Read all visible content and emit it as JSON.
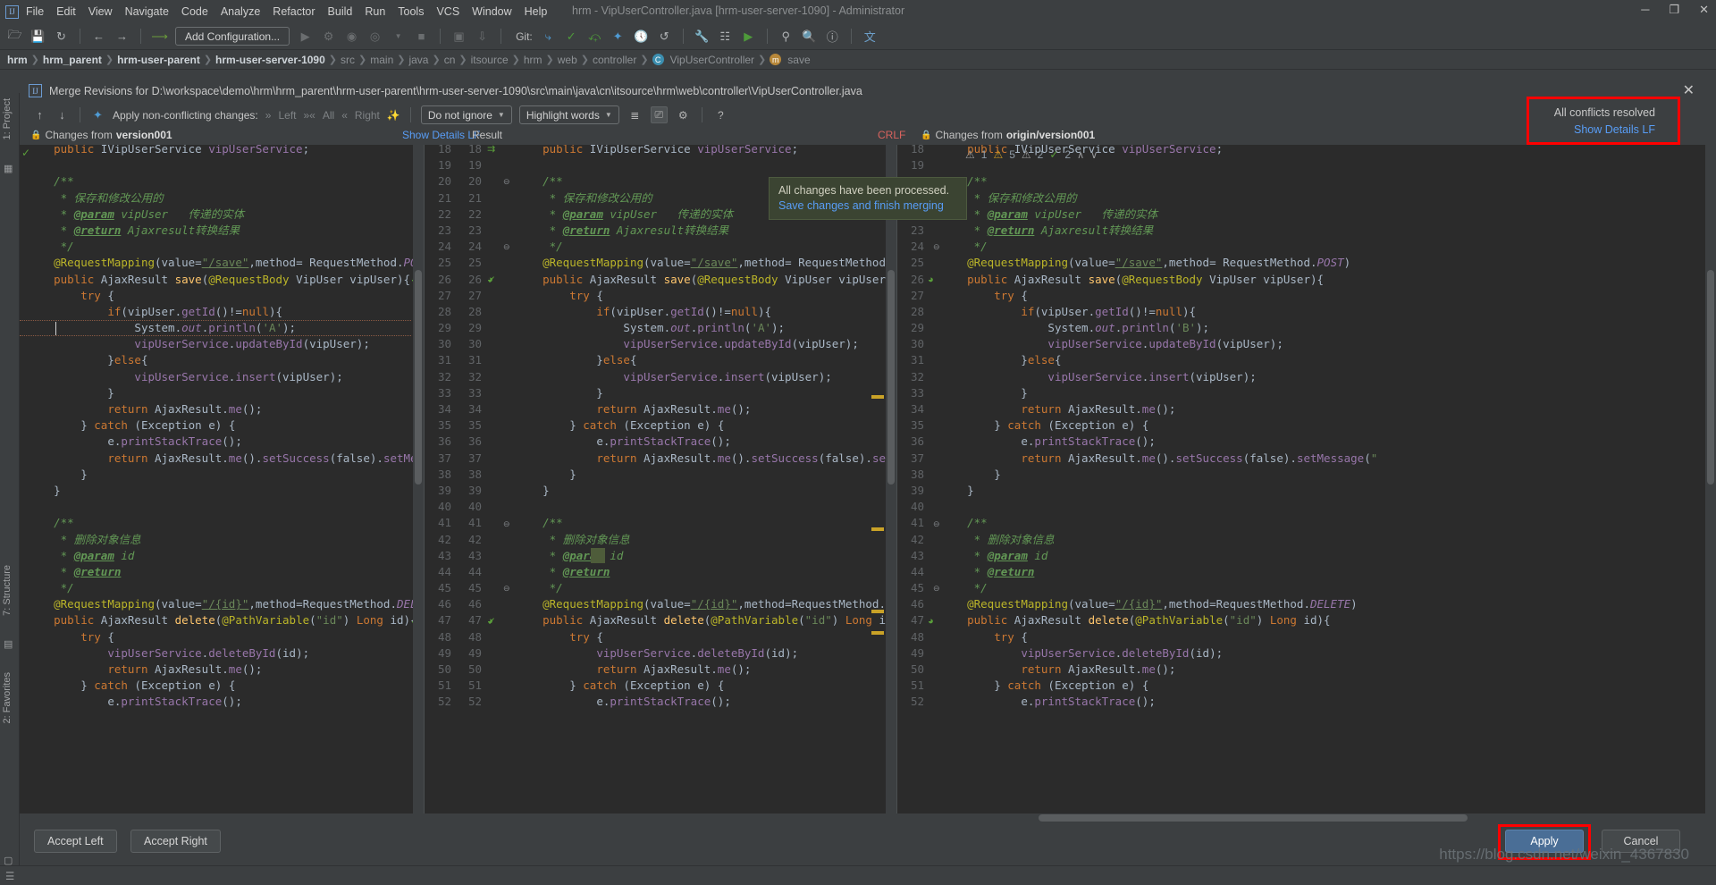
{
  "window": {
    "title": "hrm - VipUserController.java [hrm-user-server-1090] - Administrator",
    "minimize": "─",
    "maximize": "❐",
    "close": "✕",
    "logo": "IJ"
  },
  "menu": [
    "File",
    "Edit",
    "View",
    "Navigate",
    "Code",
    "Analyze",
    "Refactor",
    "Build",
    "Run",
    "Tools",
    "VCS",
    "Window",
    "Help"
  ],
  "toolbar": {
    "add_configuration": "Add Configuration...",
    "git_label": "Git:",
    "icons": [
      "folder-open-icon",
      "save-icon",
      "sync-icon",
      "back-arrow-icon",
      "forward-arrow-icon",
      "undo-arrow-icon",
      "run-icon",
      "debug-icon",
      "run-coverage-icon",
      "profile-icon",
      "stop-icon",
      "build-icon",
      "build-module-icon",
      "update-project-icon",
      "commit-icon",
      "push-icon",
      "revert-icon",
      "history-icon",
      "undo-icon",
      "settings-wrench-icon",
      "project-structure-icon",
      "run-anything-icon",
      "search-everywhere-icon",
      "search-icon",
      "help-icon",
      "translate-icon"
    ]
  },
  "breadcrumbs": [
    {
      "label": "hrm",
      "style": "bold"
    },
    {
      "label": "hrm_parent",
      "style": "bold"
    },
    {
      "label": "hrm-user-parent",
      "style": "bold"
    },
    {
      "label": "hrm-user-server-1090",
      "style": "bold"
    },
    {
      "label": "src",
      "style": "dim"
    },
    {
      "label": "main",
      "style": "dim"
    },
    {
      "label": "java",
      "style": "dim"
    },
    {
      "label": "cn",
      "style": "dim"
    },
    {
      "label": "itsource",
      "style": "dim"
    },
    {
      "label": "hrm",
      "style": "dim"
    },
    {
      "label": "web",
      "style": "dim"
    },
    {
      "label": "controller",
      "style": "dim"
    },
    {
      "label": "VipUserController",
      "style": "class",
      "badge": "C"
    },
    {
      "label": "save",
      "style": "method",
      "badge": "m"
    }
  ],
  "left_strip": {
    "project_tab": "1: Project",
    "structure_tab": "7: Structure",
    "favorites_tab": "2: Favorites"
  },
  "editor_tab": "VipUserController.java",
  "merge_dialog": {
    "title": "Merge Revisions for D:\\workspace\\demo\\hrm\\hrm_parent\\hrm-user-parent\\hrm-user-server-1090\\src\\main\\java\\cn\\itsource\\hrm\\web\\controller\\VipUserController.java",
    "close_label": "✕",
    "apply_nonconflicting_label": "Apply non-conflicting changes:",
    "apply_left": "Left",
    "apply_all": "All",
    "apply_right": "Right",
    "ignore_select": "Do not ignore",
    "highlight_select": "Highlight words",
    "help_label": "?",
    "panes": {
      "left_title_prefix": "Changes from ",
      "left_title_rev": "version001",
      "show_details_left": "Show Details LF",
      "result_title": "Result",
      "crlf": "CRLF",
      "right_title_prefix": "Changes from ",
      "right_title_rev": "origin/version001",
      "show_details_right": "Show Details LF"
    },
    "inspection_widget": {
      "errors": "1",
      "warnings": "5",
      "weak_warnings": "2",
      "ok": "2",
      "up": "∧",
      "down": "∨"
    },
    "tooltip": {
      "line1": "All changes have been processed.",
      "line2": "Save changes and finish merging"
    },
    "resolved_badge": {
      "line1": "All conflicts resolved",
      "line2": "Show Details LF"
    },
    "buttons": {
      "accept_left": "Accept Left",
      "accept_right": "Accept Right",
      "apply": "Apply",
      "cancel": "Cancel"
    }
  },
  "code": {
    "left_start_line": 18,
    "lines_left": [
      {
        "n": 18,
        "t": "    public IVipUserService vipUserService;",
        "mark": "ok"
      },
      {
        "n": 19,
        "t": ""
      },
      {
        "n": 20,
        "t": "    /**",
        "fold": true
      },
      {
        "n": 21,
        "t": "     * 保存和修改公用的"
      },
      {
        "n": 22,
        "t": "     * @param vipUser   传递的实体"
      },
      {
        "n": 23,
        "t": "     * @return Ajaxresult转换结果"
      },
      {
        "n": 24,
        "t": "     */",
        "fold": true
      },
      {
        "n": 25,
        "t": "    @RequestMapping(value=\"/save\",method= RequestMethod.POST)"
      },
      {
        "n": 26,
        "t": "    public AjaxResult save(@RequestBody VipUser vipUser){",
        "bean": true
      },
      {
        "n": 27,
        "t": "        try {"
      },
      {
        "n": 28,
        "t": "            if(vipUser.getId()!=null){"
      },
      {
        "n": 29,
        "t": "                System.out.println('A');",
        "caret": true
      },
      {
        "n": 30,
        "t": "                vipUserService.updateById(vipUser);"
      },
      {
        "n": 31,
        "t": "            }else{"
      },
      {
        "n": 32,
        "t": "                vipUserService.insert(vipUser);"
      },
      {
        "n": 33,
        "t": "            }"
      },
      {
        "n": 34,
        "t": "            return AjaxResult.me();"
      },
      {
        "n": 35,
        "t": "        } catch (Exception e) {"
      },
      {
        "n": 36,
        "t": "            e.printStackTrace();"
      },
      {
        "n": 37,
        "t": "            return AjaxResult.me().setSuccess(false).setMessage"
      },
      {
        "n": 38,
        "t": "        }"
      },
      {
        "n": 39,
        "t": "    }"
      },
      {
        "n": 40,
        "t": ""
      },
      {
        "n": 41,
        "t": "    /**",
        "fold": true
      },
      {
        "n": 42,
        "t": "     * 删除对象信息"
      },
      {
        "n": 43,
        "t": "     * @param id"
      },
      {
        "n": 44,
        "t": "     * @return"
      },
      {
        "n": 45,
        "t": "     */",
        "fold": true
      },
      {
        "n": 46,
        "t": "    @RequestMapping(value=\"/{id}\",method=RequestMethod.DELETE)"
      },
      {
        "n": 47,
        "t": "    public AjaxResult delete(@PathVariable(\"id\") Long id){",
        "bean": true
      },
      {
        "n": 48,
        "t": "        try {"
      },
      {
        "n": 49,
        "t": "            vipUserService.deleteById(id);"
      },
      {
        "n": 50,
        "t": "            return AjaxResult.me();"
      },
      {
        "n": 51,
        "t": "        } catch (Exception e) {"
      },
      {
        "n": 52,
        "t": "            e.printStackTrace();"
      }
    ],
    "lines_center": [
      {
        "n": 18,
        "t": "    public IVipUserService vipUserService;",
        "mark": "merge"
      },
      {
        "n": 19,
        "t": ""
      },
      {
        "n": 20,
        "t": "    /**",
        "fold": true
      },
      {
        "n": 21,
        "t": "     * 保存和修改公用的"
      },
      {
        "n": 22,
        "t": "     * @param vipUser   传递的实体"
      },
      {
        "n": 23,
        "t": "     * @return Ajaxresult转换结果"
      },
      {
        "n": 24,
        "t": "     */",
        "fold": true
      },
      {
        "n": 25,
        "t": "    @RequestMapping(value=\"/save\",method= RequestMethod.POST)"
      },
      {
        "n": 26,
        "t": "    public AjaxResult save(@RequestBody VipUser vipUser){",
        "bean": true,
        "mark": "ok"
      },
      {
        "n": 27,
        "t": "        try {"
      },
      {
        "n": 28,
        "t": "            if(vipUser.getId()!=null){"
      },
      {
        "n": 29,
        "t": "                System.out.println('A');"
      },
      {
        "n": 30,
        "t": "                vipUserService.updateById(vipUser);"
      },
      {
        "n": 31,
        "t": "            }else{"
      },
      {
        "n": 32,
        "t": "                vipUserService.insert(vipUser);"
      },
      {
        "n": 33,
        "t": "            }"
      },
      {
        "n": 34,
        "t": "            return AjaxResult.me();"
      },
      {
        "n": 35,
        "t": "        } catch (Exception e) {"
      },
      {
        "n": 36,
        "t": "            e.printStackTrace();"
      },
      {
        "n": 37,
        "t": "            return AjaxResult.me().setSuccess(false).setMessage(\""
      },
      {
        "n": 38,
        "t": "        }"
      },
      {
        "n": 39,
        "t": "    }"
      },
      {
        "n": 40,
        "t": ""
      },
      {
        "n": 41,
        "t": "    /**",
        "fold": true
      },
      {
        "n": 42,
        "t": "     * 删除对象信息"
      },
      {
        "n": 43,
        "t": "     * @param id"
      },
      {
        "n": 44,
        "t": "     * @return"
      },
      {
        "n": 45,
        "t": "     */",
        "fold": true
      },
      {
        "n": 46,
        "t": "    @RequestMapping(value=\"/{id}\",method=RequestMethod.DELETE)"
      },
      {
        "n": 47,
        "t": "    public AjaxResult delete(@PathVariable(\"id\") Long id){",
        "bean": true,
        "mark": "ok"
      },
      {
        "n": 48,
        "t": "        try {"
      },
      {
        "n": 49,
        "t": "            vipUserService.deleteById(id);"
      },
      {
        "n": 50,
        "t": "            return AjaxResult.me();"
      },
      {
        "n": 51,
        "t": "        } catch (Exception e) {"
      },
      {
        "n": 52,
        "t": "            e.printStackTrace();"
      }
    ],
    "lines_right": [
      {
        "n": 18,
        "t": "    public IVipUserService vipUserService;"
      },
      {
        "n": 19,
        "t": ""
      },
      {
        "n": 20,
        "t": "    /**",
        "fold": true
      },
      {
        "n": 21,
        "t": "     * 保存和修改公用的"
      },
      {
        "n": 22,
        "t": "     * @param vipUser   传递的实体"
      },
      {
        "n": 23,
        "t": "     * @return Ajaxresult转换结果"
      },
      {
        "n": 24,
        "t": "     */",
        "fold": true
      },
      {
        "n": 25,
        "t": "    @RequestMapping(value=\"/save\",method= RequestMethod.POST)"
      },
      {
        "n": 26,
        "t": "    public AjaxResult save(@RequestBody VipUser vipUser){",
        "bean": true
      },
      {
        "n": 27,
        "t": "        try {"
      },
      {
        "n": 28,
        "t": "            if(vipUser.getId()!=null){"
      },
      {
        "n": 29,
        "t": "                System.out.println('B');"
      },
      {
        "n": 30,
        "t": "                vipUserService.updateById(vipUser);"
      },
      {
        "n": 31,
        "t": "            }else{"
      },
      {
        "n": 32,
        "t": "                vipUserService.insert(vipUser);"
      },
      {
        "n": 33,
        "t": "            }"
      },
      {
        "n": 34,
        "t": "            return AjaxResult.me();"
      },
      {
        "n": 35,
        "t": "        } catch (Exception e) {"
      },
      {
        "n": 36,
        "t": "            e.printStackTrace();"
      },
      {
        "n": 37,
        "t": "            return AjaxResult.me().setSuccess(false).setMessage(\""
      },
      {
        "n": 38,
        "t": "        }"
      },
      {
        "n": 39,
        "t": "    }"
      },
      {
        "n": 40,
        "t": ""
      },
      {
        "n": 41,
        "t": "    /**",
        "fold": true
      },
      {
        "n": 42,
        "t": "     * 删除对象信息"
      },
      {
        "n": 43,
        "t": "     * @param id"
      },
      {
        "n": 44,
        "t": "     * @return"
      },
      {
        "n": 45,
        "t": "     */",
        "fold": true
      },
      {
        "n": 46,
        "t": "    @RequestMapping(value=\"/{id}\",method=RequestMethod.DELETE)"
      },
      {
        "n": 47,
        "t": "    public AjaxResult delete(@PathVariable(\"id\") Long id){",
        "bean": true
      },
      {
        "n": 48,
        "t": "        try {"
      },
      {
        "n": 49,
        "t": "            vipUserService.deleteById(id);"
      },
      {
        "n": 50,
        "t": "            return AjaxResult.me();"
      },
      {
        "n": 51,
        "t": "        } catch (Exception e) {"
      },
      {
        "n": 52,
        "t": "            e.printStackTrace();"
      }
    ]
  },
  "watermark": "https://blog.csdn.net/weixin_4367830",
  "colors": {
    "accent_blue": "#589df6",
    "conflict_red": "#f00",
    "notification_bg": "#3b4432",
    "editor_bg": "#2b2b2b",
    "chrome_bg": "#3c3f41"
  }
}
